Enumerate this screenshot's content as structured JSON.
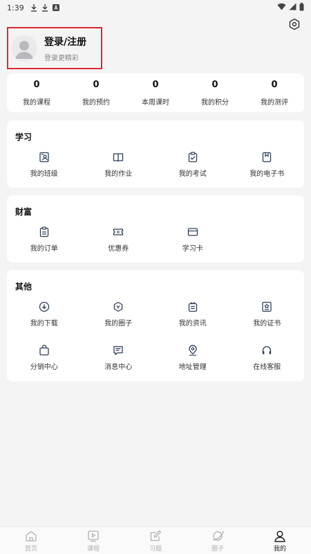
{
  "status_bar": {
    "time": "1:39",
    "icons": [
      "download-icon",
      "download-icon",
      "a-badge-icon",
      "wifi-icon",
      "signal-icon",
      "battery-icon"
    ]
  },
  "profile": {
    "title": "登录/注册",
    "subtitle": "登录更精彩"
  },
  "stats": [
    {
      "value": "0",
      "label": "我的课程"
    },
    {
      "value": "0",
      "label": "我的预约"
    },
    {
      "value": "0",
      "label": "本周课时"
    },
    {
      "value": "0",
      "label": "我的积分"
    },
    {
      "value": "0",
      "label": "我的测评"
    }
  ],
  "sections": {
    "study": {
      "title": "学习",
      "items": [
        {
          "label": "我的班级",
          "icon": "class-icon"
        },
        {
          "label": "我的作业",
          "icon": "homework-icon"
        },
        {
          "label": "我的考试",
          "icon": "exam-icon"
        },
        {
          "label": "我的电子书",
          "icon": "ebook-icon"
        }
      ]
    },
    "wealth": {
      "title": "财富",
      "items": [
        {
          "label": "我的订单",
          "icon": "order-icon"
        },
        {
          "label": "优惠券",
          "icon": "coupon-icon"
        },
        {
          "label": "学习卡",
          "icon": "study-card-icon"
        }
      ]
    },
    "other": {
      "title": "其他",
      "items": [
        {
          "label": "我的下载",
          "icon": "download-icon"
        },
        {
          "label": "我的圈子",
          "icon": "circle-icon"
        },
        {
          "label": "我的资讯",
          "icon": "news-icon"
        },
        {
          "label": "我的证书",
          "icon": "certificate-icon"
        },
        {
          "label": "分销中心",
          "icon": "bag-icon"
        },
        {
          "label": "消息中心",
          "icon": "message-icon"
        },
        {
          "label": "地址管理",
          "icon": "location-icon"
        },
        {
          "label": "在线客服",
          "icon": "headset-icon"
        }
      ]
    }
  },
  "tabbar": [
    {
      "label": "首页",
      "icon": "home-icon",
      "active": false
    },
    {
      "label": "课程",
      "icon": "video-icon",
      "active": false
    },
    {
      "label": "习题",
      "icon": "edit-icon",
      "active": false
    },
    {
      "label": "圈子",
      "icon": "planet-icon",
      "active": false
    },
    {
      "label": "我的",
      "icon": "person-icon",
      "active": true
    }
  ],
  "colors": {
    "highlight_border": "#e0282e",
    "icon_stroke": "#2e3f57",
    "tab_inactive": "#b0b0b0",
    "tab_active": "#222222"
  }
}
